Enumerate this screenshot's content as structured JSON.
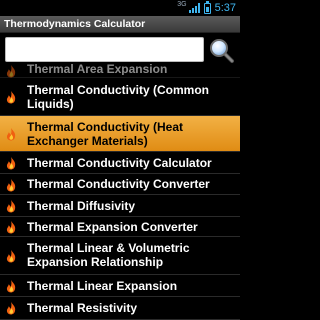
{
  "status": {
    "network": "3G",
    "time": "5:37"
  },
  "app": {
    "title": "Thermodynamics Calculator"
  },
  "search": {
    "value": "",
    "placeholder": ""
  },
  "list": {
    "items": [
      {
        "label": "Thermal Area Expansion",
        "state": "partially-visible"
      },
      {
        "label": "Thermal Conductivity (Common Liquids)"
      },
      {
        "label": "Thermal Conductivity (Heat Exchanger Materials)",
        "state": "selected"
      },
      {
        "label": "Thermal Conductivity Calculator"
      },
      {
        "label": "Thermal Conductivity Converter"
      },
      {
        "label": "Thermal Diffusivity"
      },
      {
        "label": "Thermal Expansion Converter"
      },
      {
        "label": "Thermal Linear & Volumetric Expansion Relationship"
      },
      {
        "label": "Thermal Linear Expansion"
      },
      {
        "label": "Thermal Resistivity"
      }
    ],
    "item_icon": "flame-icon"
  },
  "colors": {
    "selected_bg": "#e8981f",
    "status_accent": "#3fb6f0",
    "flame": "#f06010"
  }
}
